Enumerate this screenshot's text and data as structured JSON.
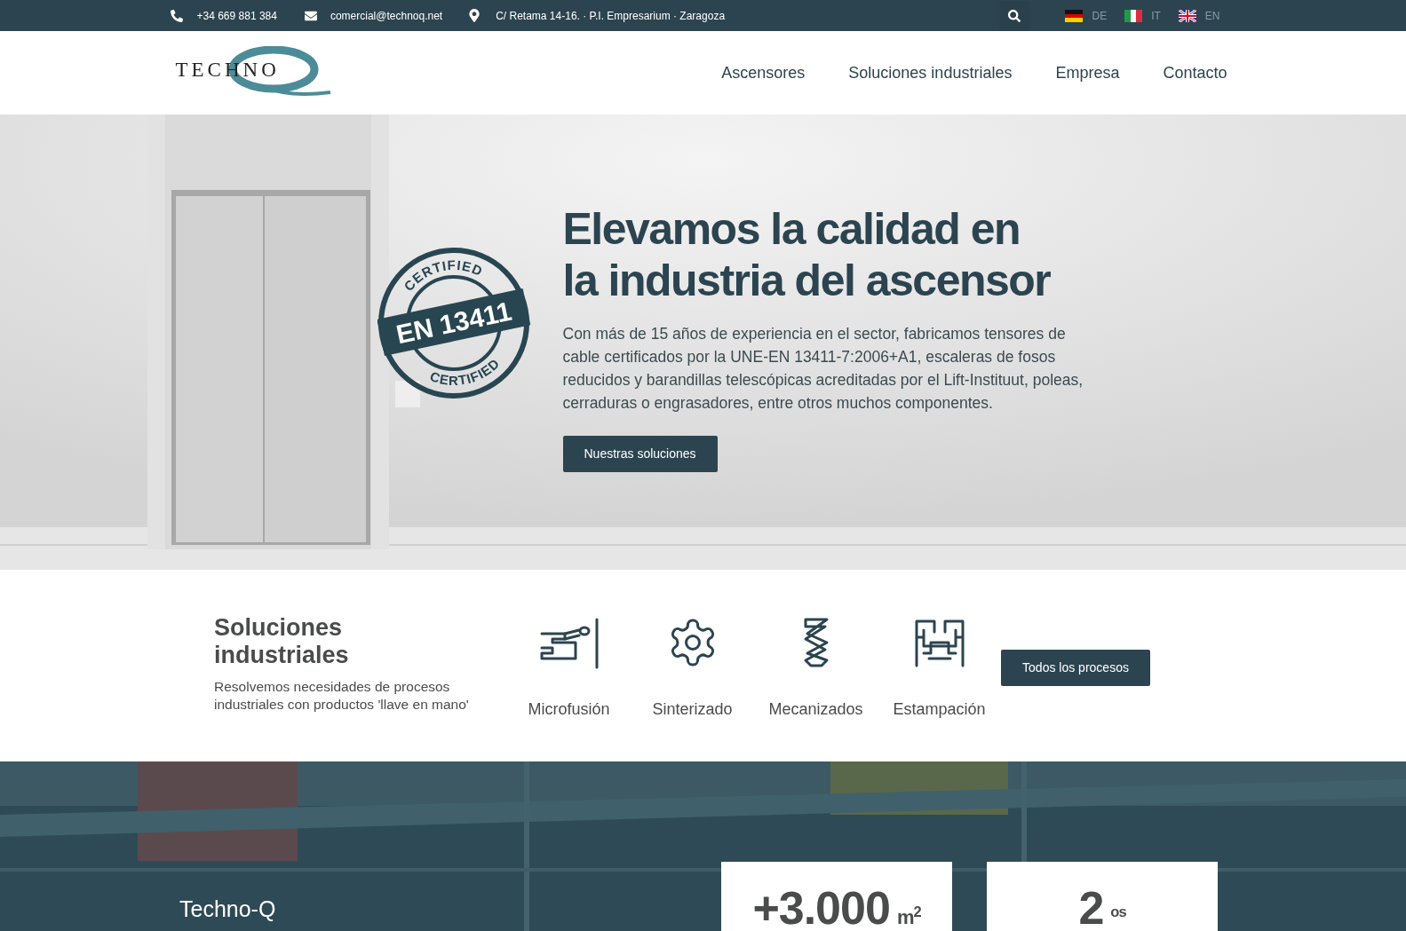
{
  "top_bar": {
    "phone": "+34 669 881 384",
    "email": "comercial@technoq.net",
    "address": "C/ Retama 14-16. · P.I. Empresarium · Zaragoza",
    "languages": [
      {
        "code": "DE",
        "kind": "de",
        "selected": false
      },
      {
        "code": "IT",
        "kind": "it",
        "selected": false
      },
      {
        "code": "EN",
        "kind": "en",
        "selected": false
      }
    ]
  },
  "header": {
    "logo": {
      "word": "TECHNO"
    },
    "nav": [
      {
        "label": "Ascensores",
        "selected": false
      },
      {
        "label": "Soluciones industriales",
        "selected": false
      },
      {
        "label": "Empresa",
        "selected": false
      },
      {
        "label": "Contacto",
        "selected": false
      }
    ]
  },
  "hero": {
    "badge": {
      "top": "CERTIFIED",
      "center": "EN 13411",
      "bottom": "CERTIFIED"
    },
    "title": [
      "Elevamos la calidad en",
      "la industria del ascensor"
    ],
    "text": "Con más de 15 años de experiencia en el sector, fabricamos tensores de cable certificados por la UNE-EN 13411-7:2006+A1, escaleras de fosos reducidos y barandillas telescópicas acreditadas por el Lift-Instituut, poleas, cerraduras o engrasadores, entre otros muchos componentes.",
    "button": "Nuestras soluciones"
  },
  "solutions": {
    "title": "Soluciones industriales",
    "text": "Resolvemos necesidades de procesos industriales con productos 'llave en mano'",
    "processes": [
      {
        "label": "Microfusión",
        "kind": "casting"
      },
      {
        "label": "Sinterizado",
        "kind": "gear"
      },
      {
        "label": "Mecanizados",
        "kind": "drill"
      },
      {
        "label": "Estampación",
        "kind": "stamp"
      }
    ],
    "button": "Todos los procesos"
  },
  "company": {
    "title": "Techno-Q",
    "stats": [
      {
        "value": "+3.000",
        "unit": "m$^{2}$"
      },
      {
        "value": "2",
        "unit": "$^{os}$"
      }
    ]
  }
}
